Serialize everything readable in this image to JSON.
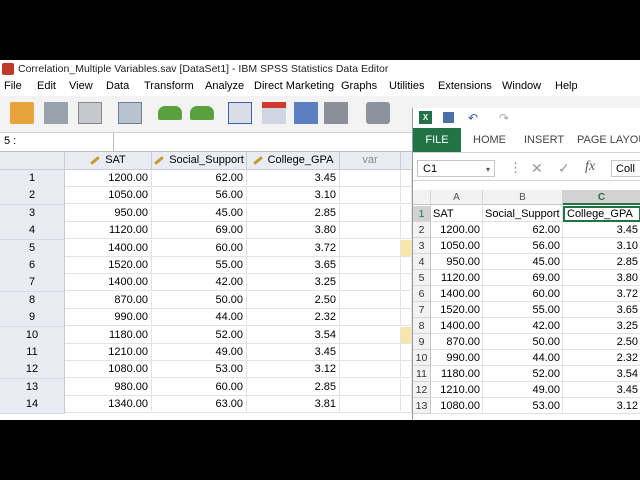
{
  "spss": {
    "title": "Correlation_Multiple Variables.sav [DataSet1] - IBM SPSS Statistics Data Editor",
    "menu": [
      "File",
      "Edit",
      "View",
      "Data",
      "Transform",
      "Analyze",
      "Direct Marketing",
      "Graphs",
      "Utilities",
      "Extensions",
      "Window",
      "Help"
    ],
    "cell_ref": "5 :",
    "columns": [
      "SAT",
      "Social_Support",
      "College_GPA",
      "var"
    ],
    "rows": [
      [
        "1",
        "1200.00",
        "62.00",
        "3.45"
      ],
      [
        "2",
        "1050.00",
        "56.00",
        "3.10"
      ],
      [
        "3",
        "950.00",
        "45.00",
        "2.85"
      ],
      [
        "4",
        "1120.00",
        "69.00",
        "3.80"
      ],
      [
        "5",
        "1400.00",
        "60.00",
        "3.72"
      ],
      [
        "6",
        "1520.00",
        "55.00",
        "3.65"
      ],
      [
        "7",
        "1400.00",
        "42.00",
        "3.25"
      ],
      [
        "8",
        "870.00",
        "50.00",
        "2.50"
      ],
      [
        "9",
        "990.00",
        "44.00",
        "2.32"
      ],
      [
        "10",
        "1180.00",
        "52.00",
        "3.54"
      ],
      [
        "11",
        "1210.00",
        "49.00",
        "3.45"
      ],
      [
        "12",
        "1080.00",
        "53.00",
        "3.12"
      ],
      [
        "13",
        "980.00",
        "60.00",
        "2.85"
      ],
      [
        "14",
        "1340.00",
        "63.00",
        "3.81"
      ]
    ]
  },
  "excel": {
    "tabs": [
      "FILE",
      "HOME",
      "INSERT",
      "PAGE LAYOUT"
    ],
    "name_box": "C1",
    "formula_text": "Coll",
    "col_letters": [
      "A",
      "B",
      "C"
    ],
    "rows": [
      [
        "1",
        "SAT",
        "Social_Support",
        "College_GPA"
      ],
      [
        "2",
        "1200.00",
        "62.00",
        "3.45"
      ],
      [
        "3",
        "1050.00",
        "56.00",
        "3.10"
      ],
      [
        "4",
        "950.00",
        "45.00",
        "2.85"
      ],
      [
        "5",
        "1120.00",
        "69.00",
        "3.80"
      ],
      [
        "6",
        "1400.00",
        "60.00",
        "3.72"
      ],
      [
        "7",
        "1520.00",
        "55.00",
        "3.65"
      ],
      [
        "8",
        "1400.00",
        "42.00",
        "3.25"
      ],
      [
        "9",
        "870.00",
        "50.00",
        "2.50"
      ],
      [
        "10",
        "990.00",
        "44.00",
        "2.32"
      ],
      [
        "11",
        "1180.00",
        "52.00",
        "3.54"
      ],
      [
        "12",
        "1210.00",
        "49.00",
        "3.45"
      ],
      [
        "13",
        "1080.00",
        "53.00",
        "3.12"
      ]
    ]
  },
  "colors": {
    "excel_green": "#217346",
    "spss_header": "#e9ecf2"
  }
}
